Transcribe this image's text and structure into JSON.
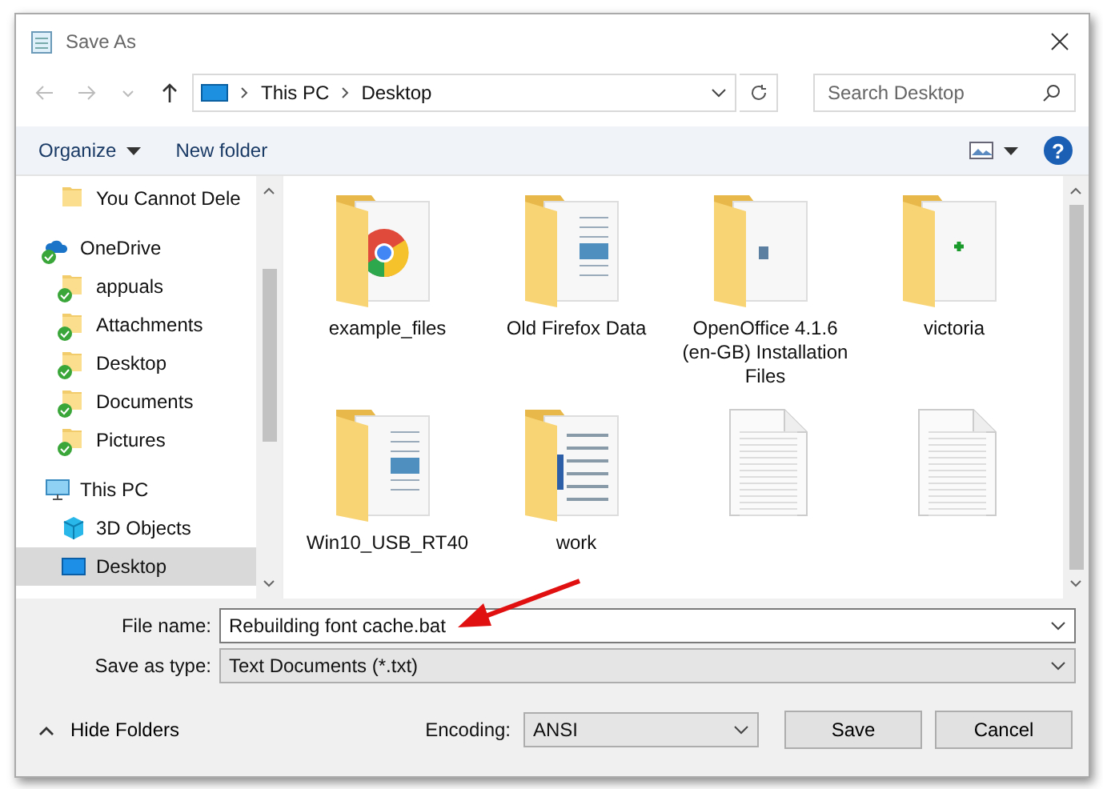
{
  "window": {
    "title": "Save As"
  },
  "address_bar": {
    "path": [
      "This PC",
      "Desktop"
    ]
  },
  "search": {
    "placeholder": "Search Desktop"
  },
  "toolbar": {
    "buttons": [
      "Organize",
      "New folder"
    ],
    "help": "?"
  },
  "sidebar": {
    "items": [
      {
        "label": "You Cannot Dele",
        "kind": "folder",
        "synced": false,
        "selected": false
      },
      {
        "label": "OneDrive",
        "kind": "cloud",
        "synced": true,
        "selected": false,
        "children": [
          {
            "label": "appuals",
            "kind": "folder",
            "synced": true,
            "selected": false
          },
          {
            "label": "Attachments",
            "kind": "folder",
            "synced": true,
            "selected": false
          },
          {
            "label": "Desktop",
            "kind": "folder",
            "synced": true,
            "selected": false
          },
          {
            "label": "Documents",
            "kind": "folder",
            "synced": true,
            "selected": false
          },
          {
            "label": "Pictures",
            "kind": "folder",
            "synced": true,
            "selected": false
          }
        ]
      },
      {
        "label": "This PC",
        "kind": "computer",
        "synced": false,
        "selected": false,
        "children": [
          {
            "label": "3D Objects",
            "kind": "cube",
            "synced": false,
            "selected": false
          },
          {
            "label": "Desktop",
            "kind": "desktop",
            "synced": false,
            "selected": true
          }
        ]
      }
    ]
  },
  "files": [
    {
      "name": "example_files",
      "kind": "chrome-folder"
    },
    {
      "name": "Old Firefox Data",
      "kind": "doc-folder"
    },
    {
      "name": "OpenOffice 4.1.6 (en-GB) Installation Files",
      "kind": "app-folder"
    },
    {
      "name": "victoria",
      "kind": "plus-folder"
    },
    {
      "name": "Win10_USB_RT40",
      "kind": "doc-folder"
    },
    {
      "name": "work",
      "kind": "paper-folder"
    },
    {
      "kind": "text-file"
    },
    {
      "kind": "text-file"
    }
  ],
  "form": {
    "file_name_label": "File name:",
    "file_name": "Rebuilding font cache.bat",
    "type_label": "Save as type:",
    "type": "Text Documents (*.txt)"
  },
  "footer": {
    "hide_folders": "Hide Folders",
    "encoding_label": "Encoding:",
    "encoding": "ANSI",
    "buttons": [
      "Save",
      "Cancel"
    ]
  }
}
